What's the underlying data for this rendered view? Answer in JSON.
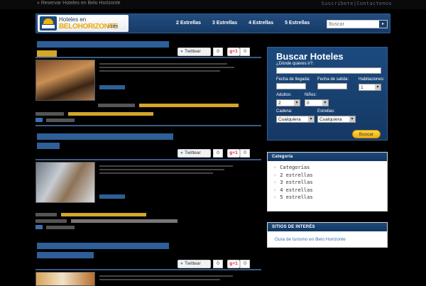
{
  "topbar": {
    "breadcrumb": "» Reservar Hoteles en Belo Horizonte",
    "links": "Suscribete|Contactenos"
  },
  "header": {
    "logo_line1": "Hoteles en",
    "logo_line2a": "BELO",
    "logo_line2b": "HORIZONTE",
    "logo_line3": ".com",
    "nav": [
      "2 Estrellas",
      "3 Estrellas",
      "4 Estrellas",
      "5 Estrellas"
    ],
    "search_placeholder": "Buscar"
  },
  "share": {
    "twitter_label": "Twittear",
    "twitter_count": "0",
    "gplus_label": "g+1",
    "gplus_count": "0"
  },
  "booking": {
    "title": "Buscar Hoteles",
    "destination_label": "¿Dónde quieres ir?:",
    "checkin_label": "Fecha de llegada:",
    "checkout_label": "Fecha de salida:",
    "rooms_label": "Habitaciones:",
    "rooms_value": "1",
    "adults_label": "Adultos:",
    "adults_value": "2",
    "children_label": "Niños:",
    "children_value": "0",
    "chain_label": "Cadena:",
    "chain_value": "Cualquiera",
    "stars_label": "Estrellas:",
    "stars_value": "Cualquiera",
    "button": "Buscar"
  },
  "categories": {
    "title": "Categoría",
    "items": [
      "Categorías",
      "2 estrellas",
      "3 estrellas",
      "4 estrellas",
      "5 estrellas"
    ]
  },
  "sites": {
    "title": "SITIOS DE INTERÉS",
    "link": "Guía de turismo en Belo Horizonte"
  }
}
